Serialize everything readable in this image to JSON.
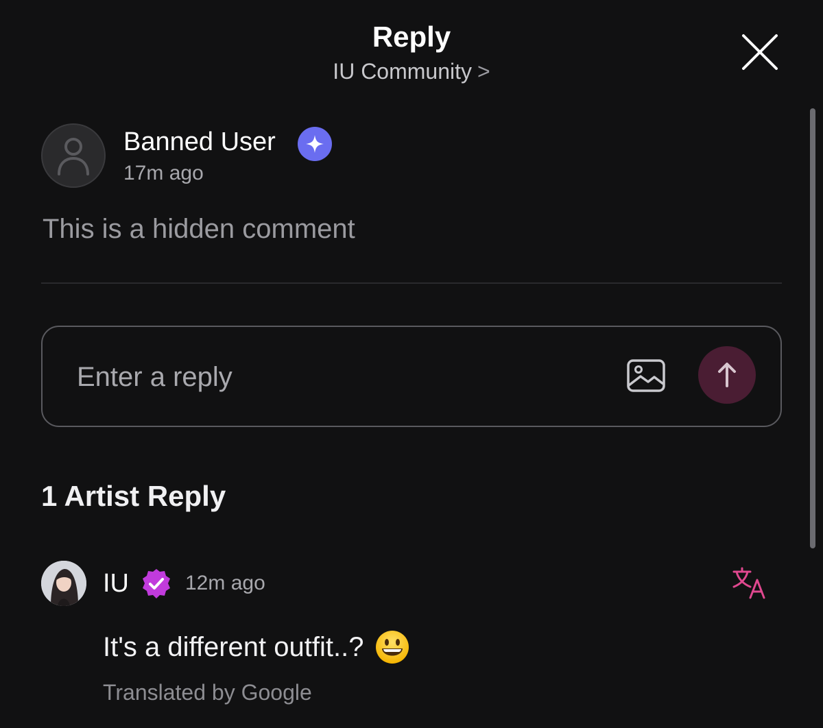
{
  "header": {
    "title": "Reply",
    "community": "IU Community",
    "chevron": ">"
  },
  "post": {
    "author": "Banned User",
    "time": "17m ago",
    "text": "This is a hidden comment",
    "badge_icon": "star-badge-icon",
    "badge_color": "#6a6df0"
  },
  "reply_box": {
    "placeholder": "Enter a reply",
    "value": "",
    "send_button_color": "#4a1d33"
  },
  "artist_replies": {
    "heading": "1 Artist Reply",
    "items": [
      {
        "author": "IU",
        "time": "12m ago",
        "text": "It's a different outfit..?",
        "emoji": "grinning-face-emoji",
        "translated_by": "Translated by Google",
        "badge_color": "#c13bdc"
      }
    ]
  },
  "colors": {
    "background": "#111112",
    "translate_accent": "#e0488f"
  }
}
